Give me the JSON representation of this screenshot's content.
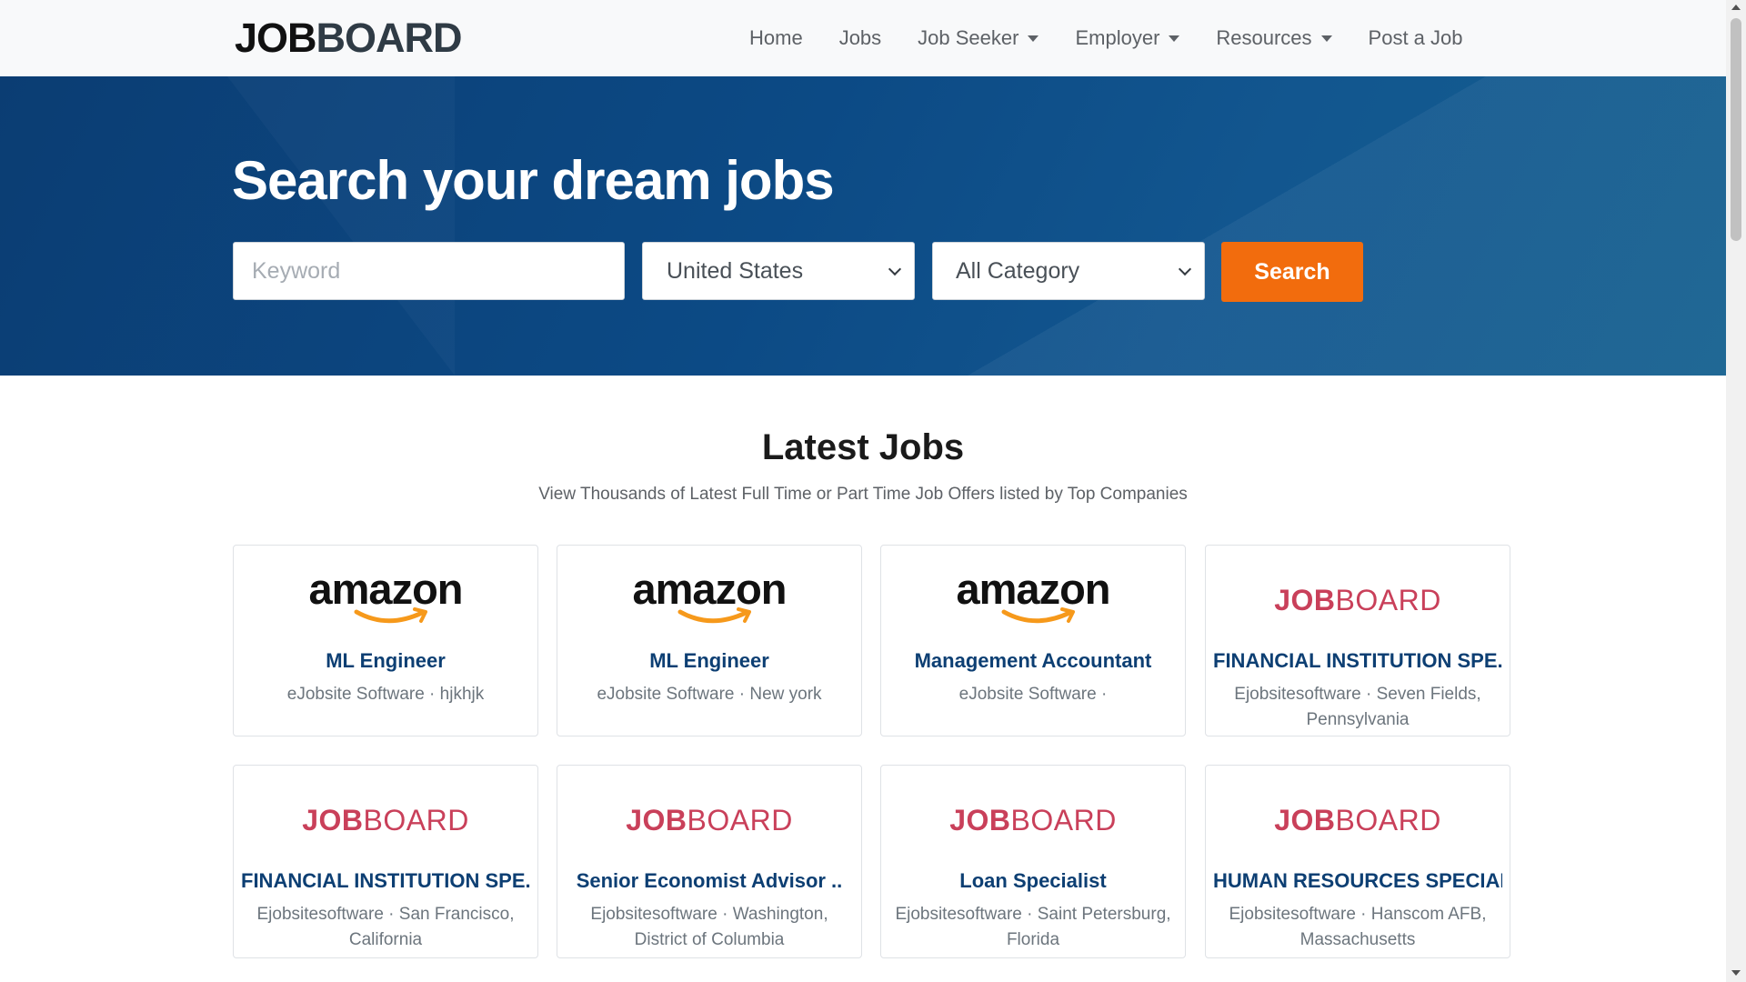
{
  "brand": {
    "part1": "JOB",
    "part2": "BOARD"
  },
  "nav": [
    {
      "label": "Home",
      "dropdown": false
    },
    {
      "label": "Jobs",
      "dropdown": false
    },
    {
      "label": "Job Seeker",
      "dropdown": true
    },
    {
      "label": "Employer",
      "dropdown": true
    },
    {
      "label": "Resources",
      "dropdown": true
    },
    {
      "label": "Post a Job",
      "dropdown": false
    }
  ],
  "hero": {
    "title": "Search your dream jobs",
    "keyword_placeholder": "Keyword",
    "keyword_value": "",
    "country_selected": "United States",
    "category_selected": "All Category",
    "search_label": "Search"
  },
  "section": {
    "title": "Latest Jobs",
    "subtitle": "View Thousands of Latest Full Time or Part Time Job Offers listed by Top Companies"
  },
  "logos": {
    "amazon": "amazon",
    "jobboard_part1": "JOB",
    "jobboard_part2": "BOARD"
  },
  "colors": {
    "accent": "#f26c0d",
    "hero": "#0c4a85",
    "link": "#0d3f73",
    "logo_red": "#c9405a"
  },
  "jobs": [
    {
      "logo": "amazon",
      "title": "ML Engineer",
      "company": "eJobsite Software",
      "location": "hjkhjk"
    },
    {
      "logo": "amazon",
      "title": "ML Engineer",
      "company": "eJobsite Software",
      "location": "New york"
    },
    {
      "logo": "amazon",
      "title": "Management Accountant",
      "company": "eJobsite Software",
      "location": ""
    },
    {
      "logo": "jobboard",
      "title": "FINANCIAL INSTITUTION SPE..",
      "company": "Ejobsitesoftware",
      "location": "Seven Fields, Pennsylvania"
    },
    {
      "logo": "jobboard",
      "title": "FINANCIAL INSTITUTION SPE..",
      "company": "Ejobsitesoftware",
      "location": "San Francisco, California"
    },
    {
      "logo": "jobboard",
      "title": "Senior Economist Advisor ..",
      "company": "Ejobsitesoftware",
      "location": "Washington, District of Columbia"
    },
    {
      "logo": "jobboard",
      "title": "Loan Specialist",
      "company": "Ejobsitesoftware",
      "location": "Saint Petersburg, Florida"
    },
    {
      "logo": "jobboard",
      "title": "HUMAN RESOURCES SPECIALIST",
      "company": "Ejobsitesoftware",
      "location": "Hanscom AFB, Massachusetts"
    }
  ]
}
